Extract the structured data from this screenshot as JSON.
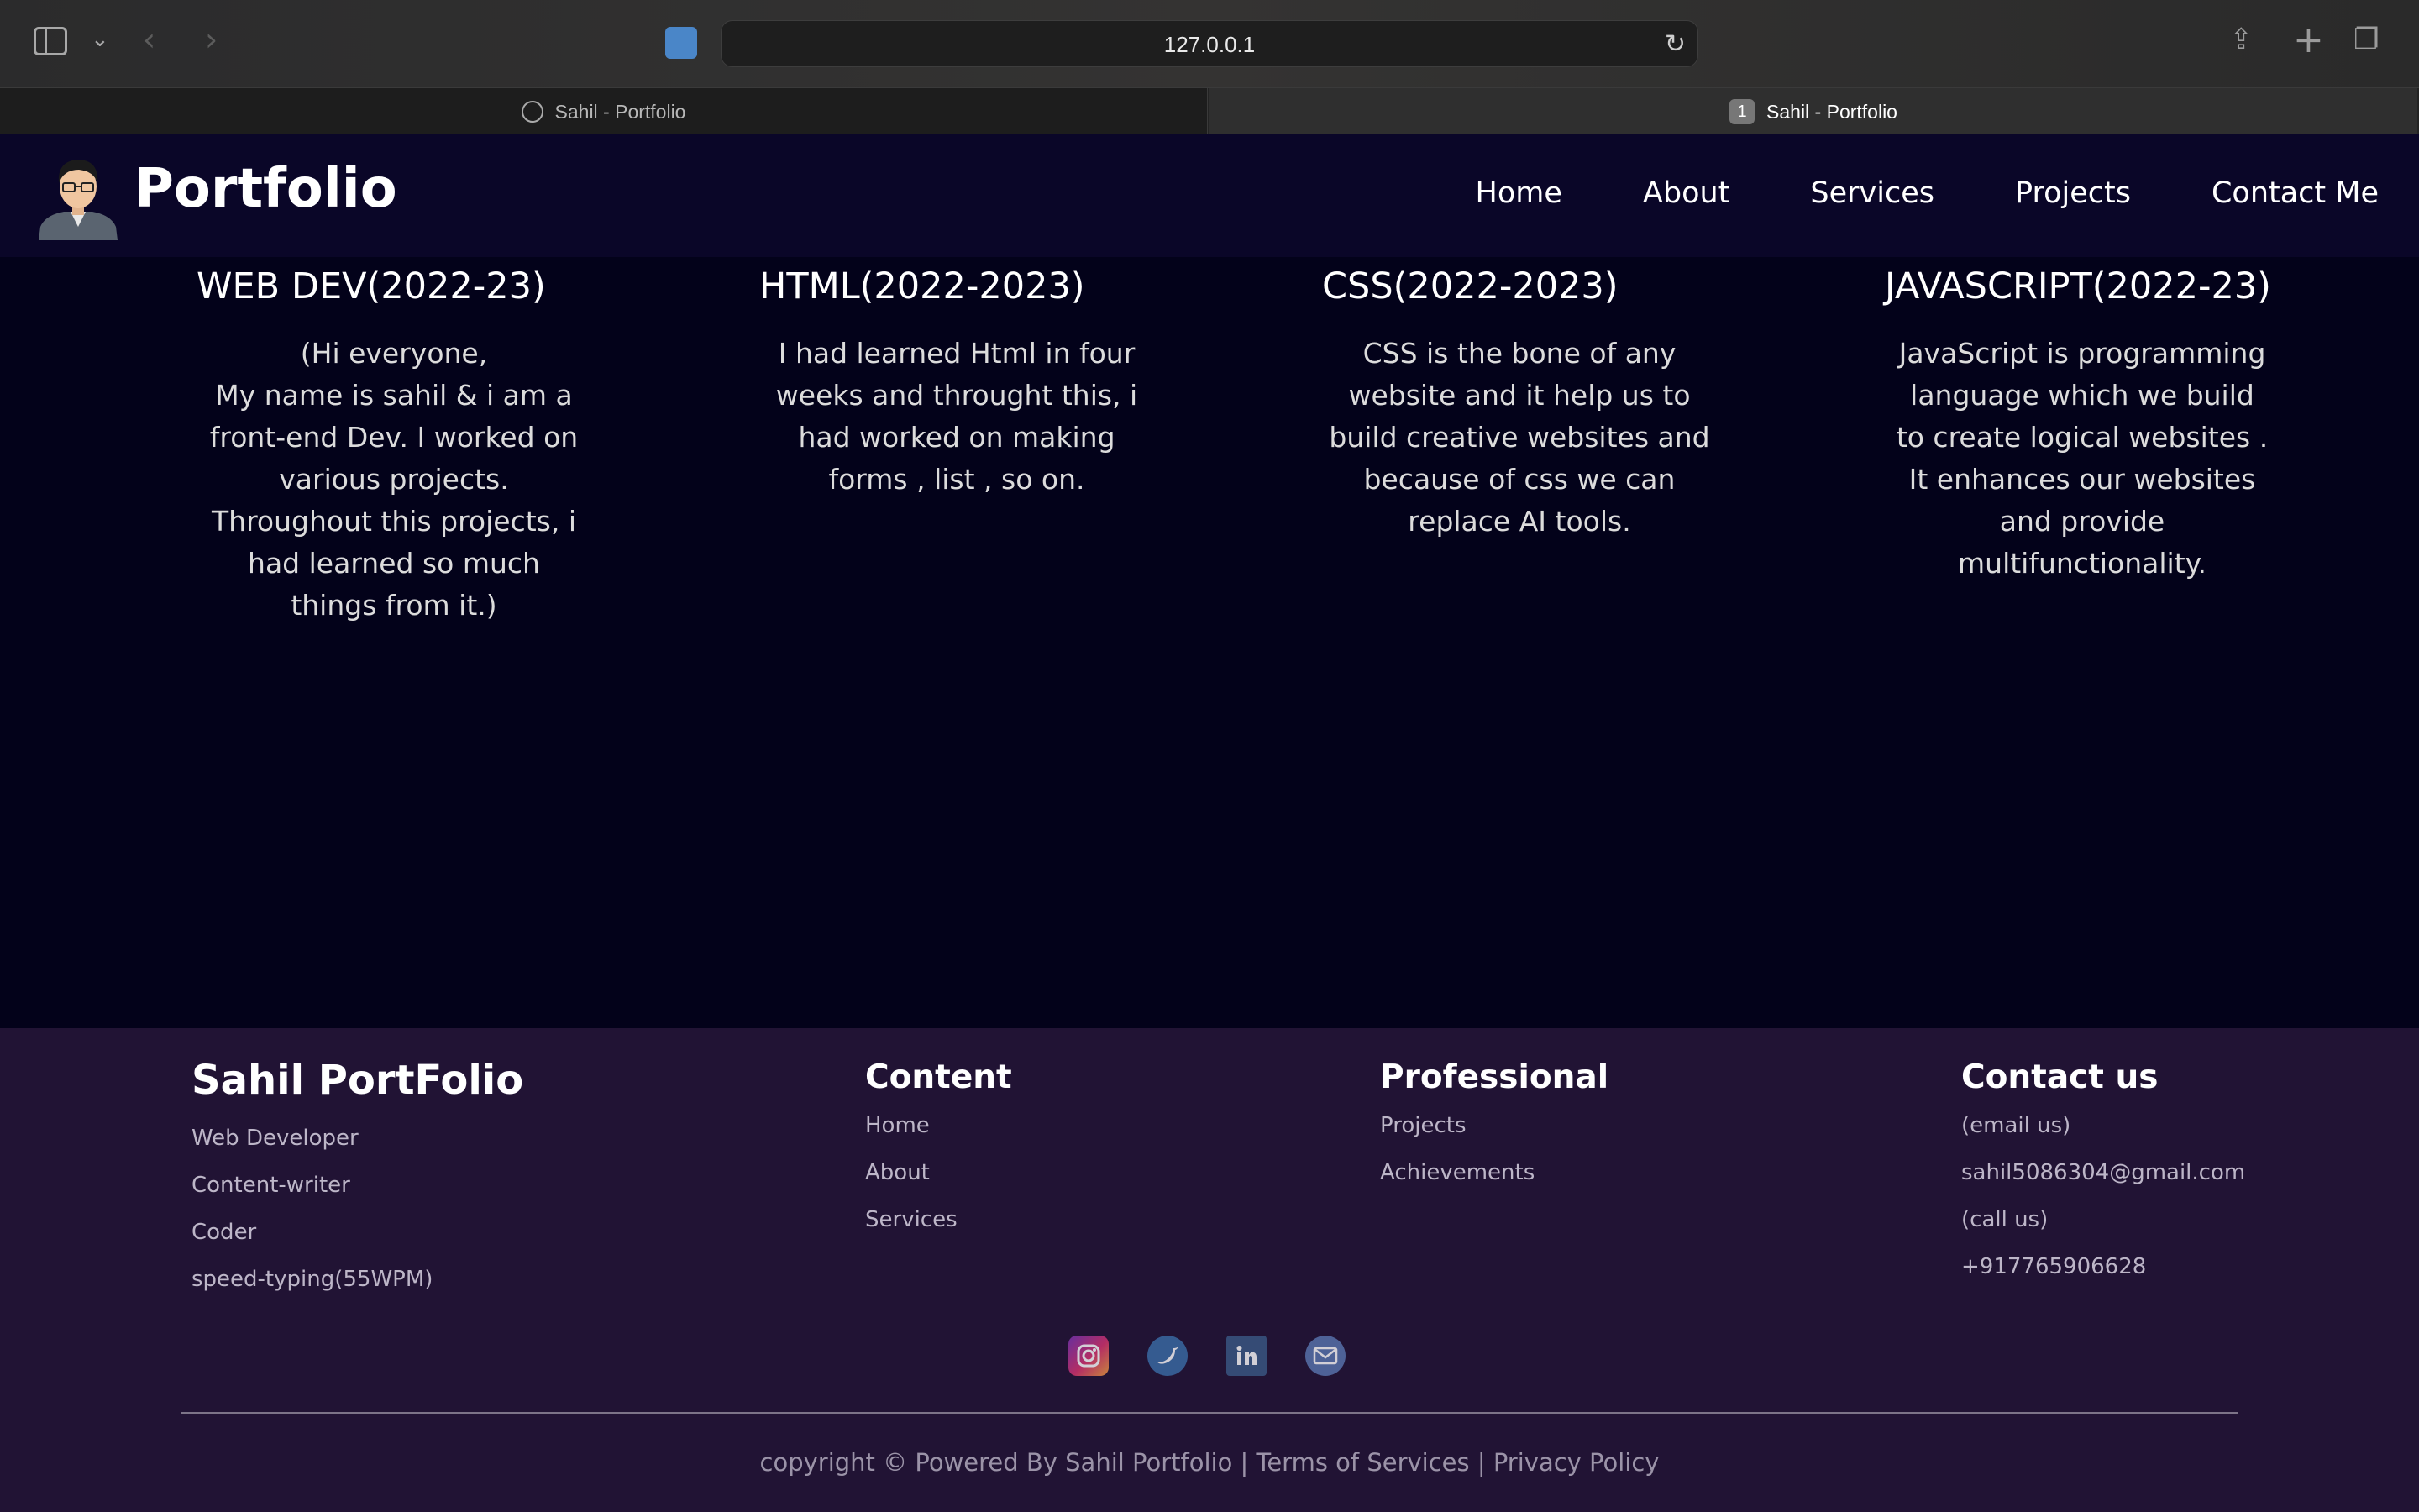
{
  "browser": {
    "url": "127.0.0.1",
    "tabs": [
      {
        "title": "Sahil - Portfolio"
      },
      {
        "title": "Sahil - Portfolio",
        "number": "1"
      }
    ]
  },
  "header": {
    "logo_text": "Portfolio",
    "nav": [
      "Home",
      "About",
      "Services",
      "Projects",
      "Contact Me"
    ]
  },
  "columns": [
    {
      "title": "WEB DEV(2022-23)",
      "lines": [
        "(Hi everyone,",
        "My name is sahil & i am a",
        "front-end Dev. I worked on",
        "various projects.",
        "Throughout this projects, i",
        "had learned so much",
        "things from it.)"
      ]
    },
    {
      "title": "HTML(2022-2023)",
      "lines": [
        "I had learned Html in four",
        "weeks and throught this, i",
        "had worked on making",
        "forms , list , so on."
      ]
    },
    {
      "title": "CSS(2022-2023)",
      "lines": [
        "CSS is the bone of any",
        "website and it help us to",
        "build creative websites and",
        "because of css we can",
        "replace AI tools."
      ]
    },
    {
      "title": "JAVASCRIPT(2022-23)",
      "lines": [
        "JavaScript is programming",
        "language which we build",
        "to create logical websites .",
        "It enhances our websites",
        "and provide",
        "multifunctionality."
      ]
    }
  ],
  "footer": {
    "brand": {
      "title": "Sahil PortFolio",
      "items": [
        "Web Developer",
        "Content-writer",
        "Coder",
        "speed-typing(55WPM)"
      ]
    },
    "content": {
      "title": "Content",
      "items": [
        "Home",
        "About",
        "Services"
      ]
    },
    "professional": {
      "title": "Professional",
      "items": [
        "Projects",
        "Achievements"
      ]
    },
    "contact": {
      "title": "Contact us",
      "items": [
        "(email us)",
        "sahil5086304@gmail.com",
        "(call us)",
        "+917765906628"
      ]
    },
    "socials": [
      "instagram-icon",
      "twitter-icon",
      "linkedin-icon",
      "email-icon"
    ],
    "copyright": "copyright © Powered By Sahil Portfolio | Terms of Services | Privacy Policy"
  }
}
